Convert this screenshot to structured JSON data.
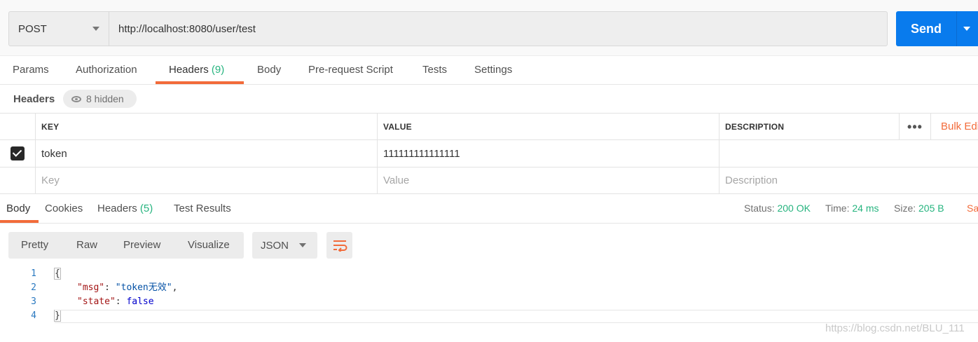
{
  "request": {
    "method": "POST",
    "url": "http://localhost:8080/user/test",
    "send_label": "Send"
  },
  "request_tabs": [
    {
      "label": "Params",
      "count": ""
    },
    {
      "label": "Authorization",
      "count": ""
    },
    {
      "label": "Headers",
      "count": "(9)"
    },
    {
      "label": "Body",
      "count": ""
    },
    {
      "label": "Pre-request Script",
      "count": ""
    },
    {
      "label": "Tests",
      "count": ""
    },
    {
      "label": "Settings",
      "count": ""
    }
  ],
  "active_request_tab": "Headers",
  "headers_section": {
    "title": "Headers",
    "hidden_label": "8 hidden"
  },
  "headers_table": {
    "columns": [
      "KEY",
      "VALUE",
      "DESCRIPTION"
    ],
    "bulk_edit": "Bulk Edi",
    "rows": [
      {
        "checked": true,
        "key": "token",
        "value": "111111111111111",
        "description": ""
      }
    ],
    "placeholder": {
      "key": "Key",
      "value": "Value",
      "description": "Description"
    }
  },
  "response_tabs": [
    {
      "label": "Body",
      "count": ""
    },
    {
      "label": "Cookies",
      "count": ""
    },
    {
      "label": "Headers",
      "count": "(5)"
    },
    {
      "label": "Test Results",
      "count": ""
    }
  ],
  "active_response_tab": "Body",
  "response_meta": {
    "status_label": "Status:",
    "status_value": "200 OK",
    "time_label": "Time:",
    "time_value": "24 ms",
    "size_label": "Size:",
    "size_value": "205 B",
    "save_label": "Sa"
  },
  "view_modes": [
    "Pretty",
    "Raw",
    "Preview",
    "Visualize"
  ],
  "format": "JSON",
  "code_lines": {
    "line_numbers": [
      "1",
      "2",
      "3",
      "4"
    ],
    "open_brace": "{",
    "msg_key": "\"msg\"",
    "msg_value": "\"token无效\"",
    "state_key": "\"state\"",
    "state_value": "false",
    "close_brace": "}"
  },
  "watermark": "https://blog.csdn.net/BLU_111",
  "colors": {
    "send_button": "#097bed",
    "accent_orange": "#f26b3a",
    "status_green": "#26b47f"
  }
}
